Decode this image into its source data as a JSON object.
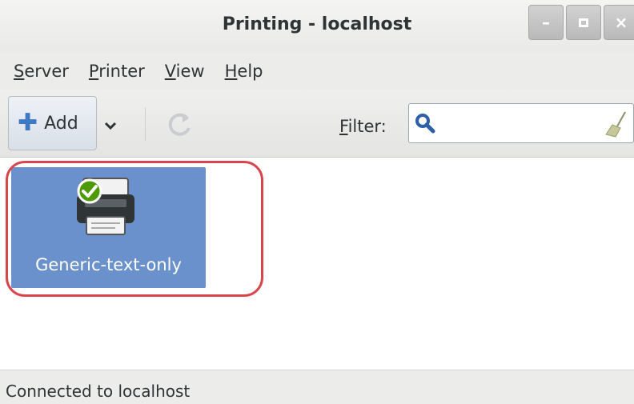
{
  "window": {
    "title": "Printing - localhost",
    "buttons": [
      "minimize-icon",
      "maximize-icon",
      "close-icon"
    ]
  },
  "menu": {
    "items": [
      {
        "first": "S",
        "rest": "erver"
      },
      {
        "first": "P",
        "rest": "rinter"
      },
      {
        "first": "V",
        "rest": "iew"
      },
      {
        "first": "H",
        "rest": "elp"
      }
    ]
  },
  "toolbar": {
    "add_label": "Add",
    "add_icon": "plus-icon",
    "dropdown_icon": "chevron-down-icon",
    "refresh_icon": "refresh-icon",
    "filter_label_first": "F",
    "filter_label_rest": "ilter:",
    "filter_value": "",
    "search_icon": "search-icon",
    "clear_icon": "broom-clear-icon"
  },
  "printers": [
    {
      "name": "Generic-text-only",
      "icon": "printer-icon",
      "default": true,
      "selected": true
    }
  ],
  "status": {
    "text": "Connected to localhost"
  },
  "colors": {
    "selection": "#6a91cc",
    "highlight_outline": "#d8454b",
    "add_icon": "#3d79c5",
    "check_badge": "#4e9a06"
  }
}
